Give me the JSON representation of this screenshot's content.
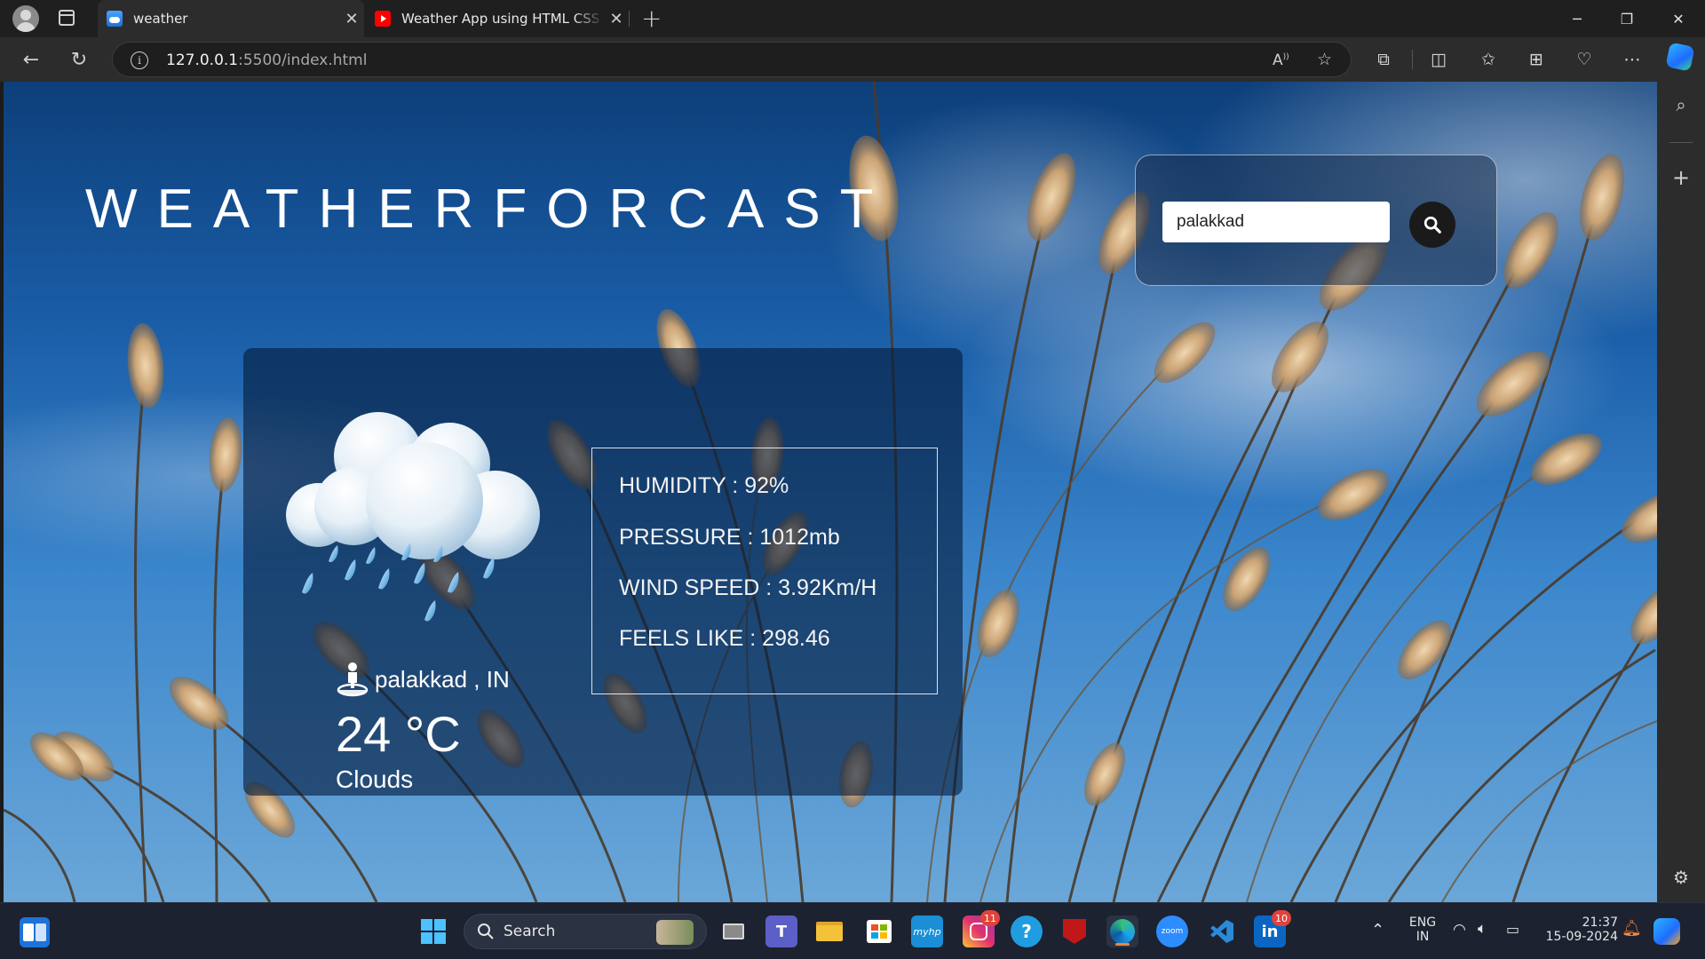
{
  "browser": {
    "tabs": [
      {
        "title": "weather",
        "icon": "weather-cloud-icon",
        "active": true
      },
      {
        "title": "Weather App using HTML CSS and JavaScript",
        "icon": "youtube-icon",
        "active": false
      }
    ],
    "address": {
      "host": "127.0.0.1",
      "path": ":5500/index.html"
    }
  },
  "page": {
    "title": "WEATHERFORCAST",
    "search": {
      "value": "palakkad"
    },
    "weather": {
      "location": "palakkad , IN",
      "temperature": "24 °C",
      "condition": "Clouds",
      "icon": "rain-cloud-icon",
      "details": {
        "humidity": "HUMIDITY : 92%",
        "pressure": "PRESSURE : 1012mb",
        "wind_speed": "WIND SPEED : 3.92Km/H",
        "feels_like": "FEELS LIKE : 298.46"
      }
    }
  },
  "taskbar": {
    "search_label": "Search",
    "language": {
      "line1": "ENG",
      "line2": "IN"
    },
    "clock": {
      "time": "21:37",
      "date": "15-09-2024"
    },
    "badges": {
      "instagram": "11",
      "linkedin": "10"
    }
  }
}
